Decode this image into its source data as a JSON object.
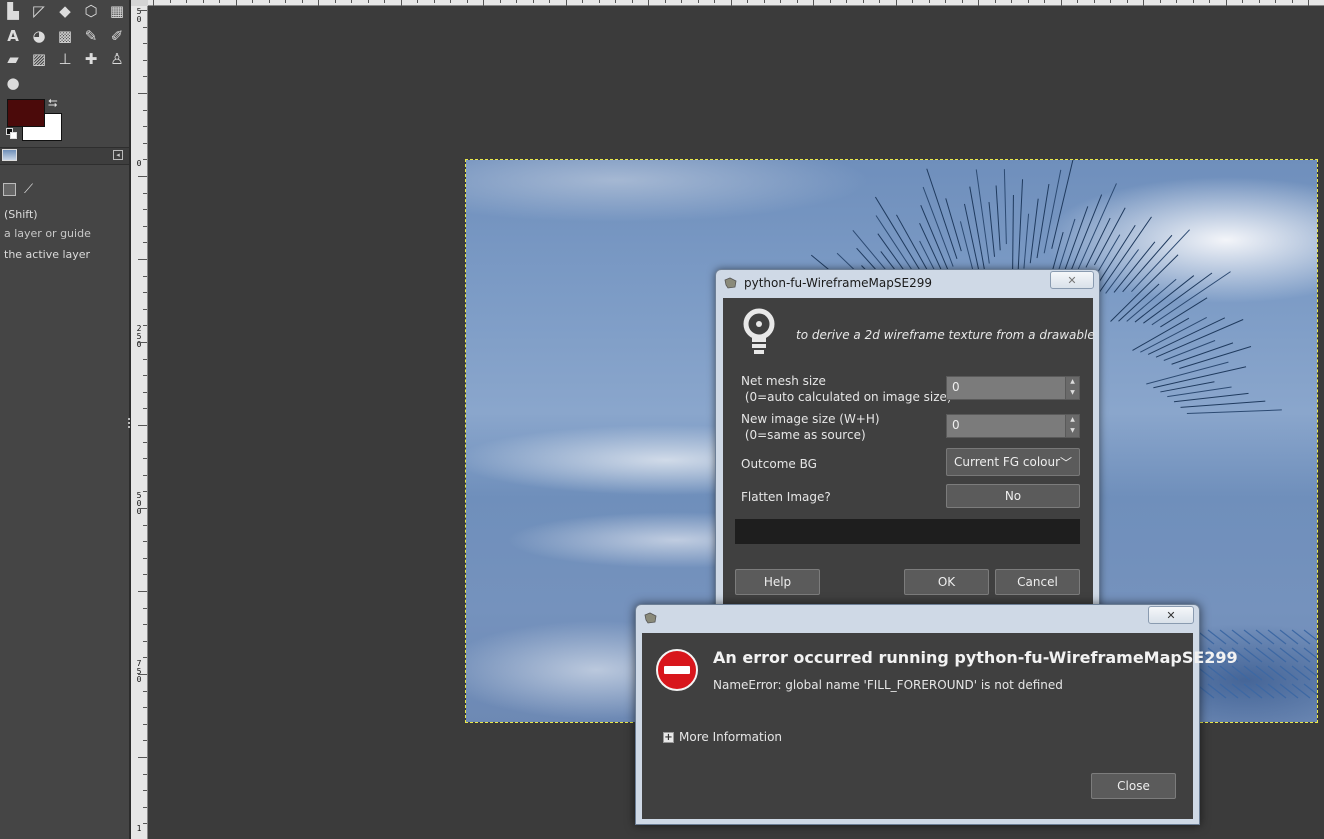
{
  "toolbox": {
    "tool_options": {
      "shift_hint": "(Shift)",
      "hint_layer_guide": "a layer or guide",
      "hint_active_layer": "the active layer"
    },
    "colors": {
      "foreground": "#4b0a0a",
      "background": "#ffffff"
    }
  },
  "rulers": {
    "left_labels": [
      "5\n0",
      "0",
      "2\n5\n0",
      "5\n0\n0",
      "7\n5\n0",
      "1"
    ]
  },
  "plugin_dialog": {
    "title": "python-fu-WireframeMapSE299",
    "description": "to derive a 2d wireframe texture from a drawable",
    "fields": {
      "net_mesh_label": "Net mesh size\n (0=auto calculated on image size)",
      "net_mesh_value": "0",
      "new_size_label": "New image size (W+H)\n (0=same as source)",
      "new_size_value": "0",
      "outcome_bg_label": "Outcome BG",
      "outcome_bg_value": "Current FG colour",
      "flatten_label": "Flatten Image?",
      "flatten_value": "No"
    },
    "buttons": {
      "help": "Help",
      "ok": "OK",
      "cancel": "Cancel"
    }
  },
  "error_dialog": {
    "title": "An error occurred running python-fu-WireframeMapSE299",
    "message": "NameError: global name 'FILL_FOREROUND' is not defined",
    "more_info": "More Information",
    "close": "Close"
  }
}
